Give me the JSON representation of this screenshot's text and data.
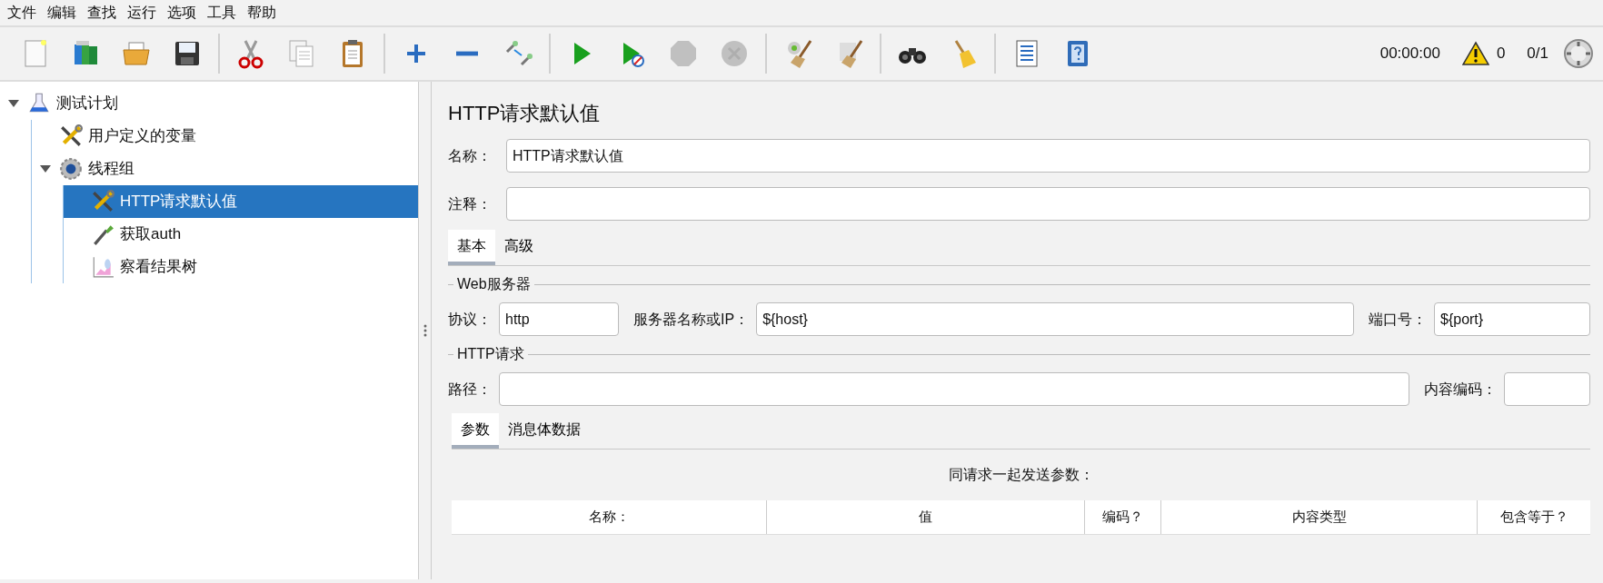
{
  "menu": [
    "文件",
    "编辑",
    "查找",
    "运行",
    "选项",
    "工具",
    "帮助"
  ],
  "toolbar": [
    {
      "kind": "new",
      "disabled": false
    },
    {
      "kind": "templates",
      "disabled": false
    },
    {
      "kind": "open",
      "disabled": false
    },
    {
      "kind": "save",
      "disabled": false
    },
    {
      "kind": "separator"
    },
    {
      "kind": "cut",
      "disabled": false
    },
    {
      "kind": "copy",
      "disabled": false
    },
    {
      "kind": "paste",
      "disabled": false
    },
    {
      "kind": "separator"
    },
    {
      "kind": "expand",
      "disabled": false
    },
    {
      "kind": "collapse",
      "disabled": false
    },
    {
      "kind": "toggle",
      "disabled": false
    },
    {
      "kind": "separator"
    },
    {
      "kind": "start",
      "disabled": false
    },
    {
      "kind": "start-no-pause",
      "disabled": false
    },
    {
      "kind": "stop",
      "disabled": true
    },
    {
      "kind": "shutdown",
      "disabled": true
    },
    {
      "kind": "separator"
    },
    {
      "kind": "clear",
      "disabled": false
    },
    {
      "kind": "clear-all",
      "disabled": false
    },
    {
      "kind": "separator"
    },
    {
      "kind": "search",
      "disabled": false
    },
    {
      "kind": "reset-search",
      "disabled": false
    },
    {
      "kind": "separator"
    },
    {
      "kind": "functions",
      "disabled": false
    },
    {
      "kind": "help",
      "disabled": false
    }
  ],
  "status": {
    "timer": "00:00:00",
    "warnings": "0",
    "threads": "0/1"
  },
  "tree": [
    {
      "label": "测试计划",
      "kind": "flask",
      "expanded": true,
      "selected": false,
      "children": [
        {
          "label": "用户定义的变量",
          "kind": "tools",
          "selected": false
        },
        {
          "label": "线程组",
          "kind": "gear",
          "expanded": true,
          "selected": false,
          "children": [
            {
              "label": "HTTP请求默认值",
              "kind": "tools",
              "selected": true
            },
            {
              "label": "获取auth",
              "kind": "dropper",
              "selected": false
            },
            {
              "label": "察看结果树",
              "kind": "chart",
              "selected": false
            }
          ]
        }
      ]
    }
  ],
  "panel": {
    "title": "HTTP请求默认值",
    "name": {
      "label": "名称：",
      "value": "HTTP请求默认值"
    },
    "comments": {
      "label": "注释："
    },
    "tabs": [
      {
        "label": "基本",
        "selected": true
      },
      {
        "label": "高级",
        "selected": false
      }
    ],
    "web_server": {
      "legend": "Web服务器",
      "fields": [
        {
          "label": "协议：",
          "value": "http"
        },
        {
          "label": "服务器名称或IP：",
          "value": "${host}"
        },
        {
          "label": "端口号：",
          "value": "${port}"
        }
      ]
    },
    "http_request": {
      "legend": "HTTP请求",
      "fields": [
        {
          "label": "路径："
        },
        {
          "label": "内容编码："
        }
      ]
    },
    "sub_tabs": [
      {
        "label": "参数",
        "selected": true
      },
      {
        "label": "消息体数据",
        "selected": false
      }
    ],
    "parameters": {
      "caption": "同请求一起发送参数：",
      "columns": [
        "名称：",
        "值",
        "编码？",
        "内容类型",
        "包含等于？"
      ]
    }
  }
}
